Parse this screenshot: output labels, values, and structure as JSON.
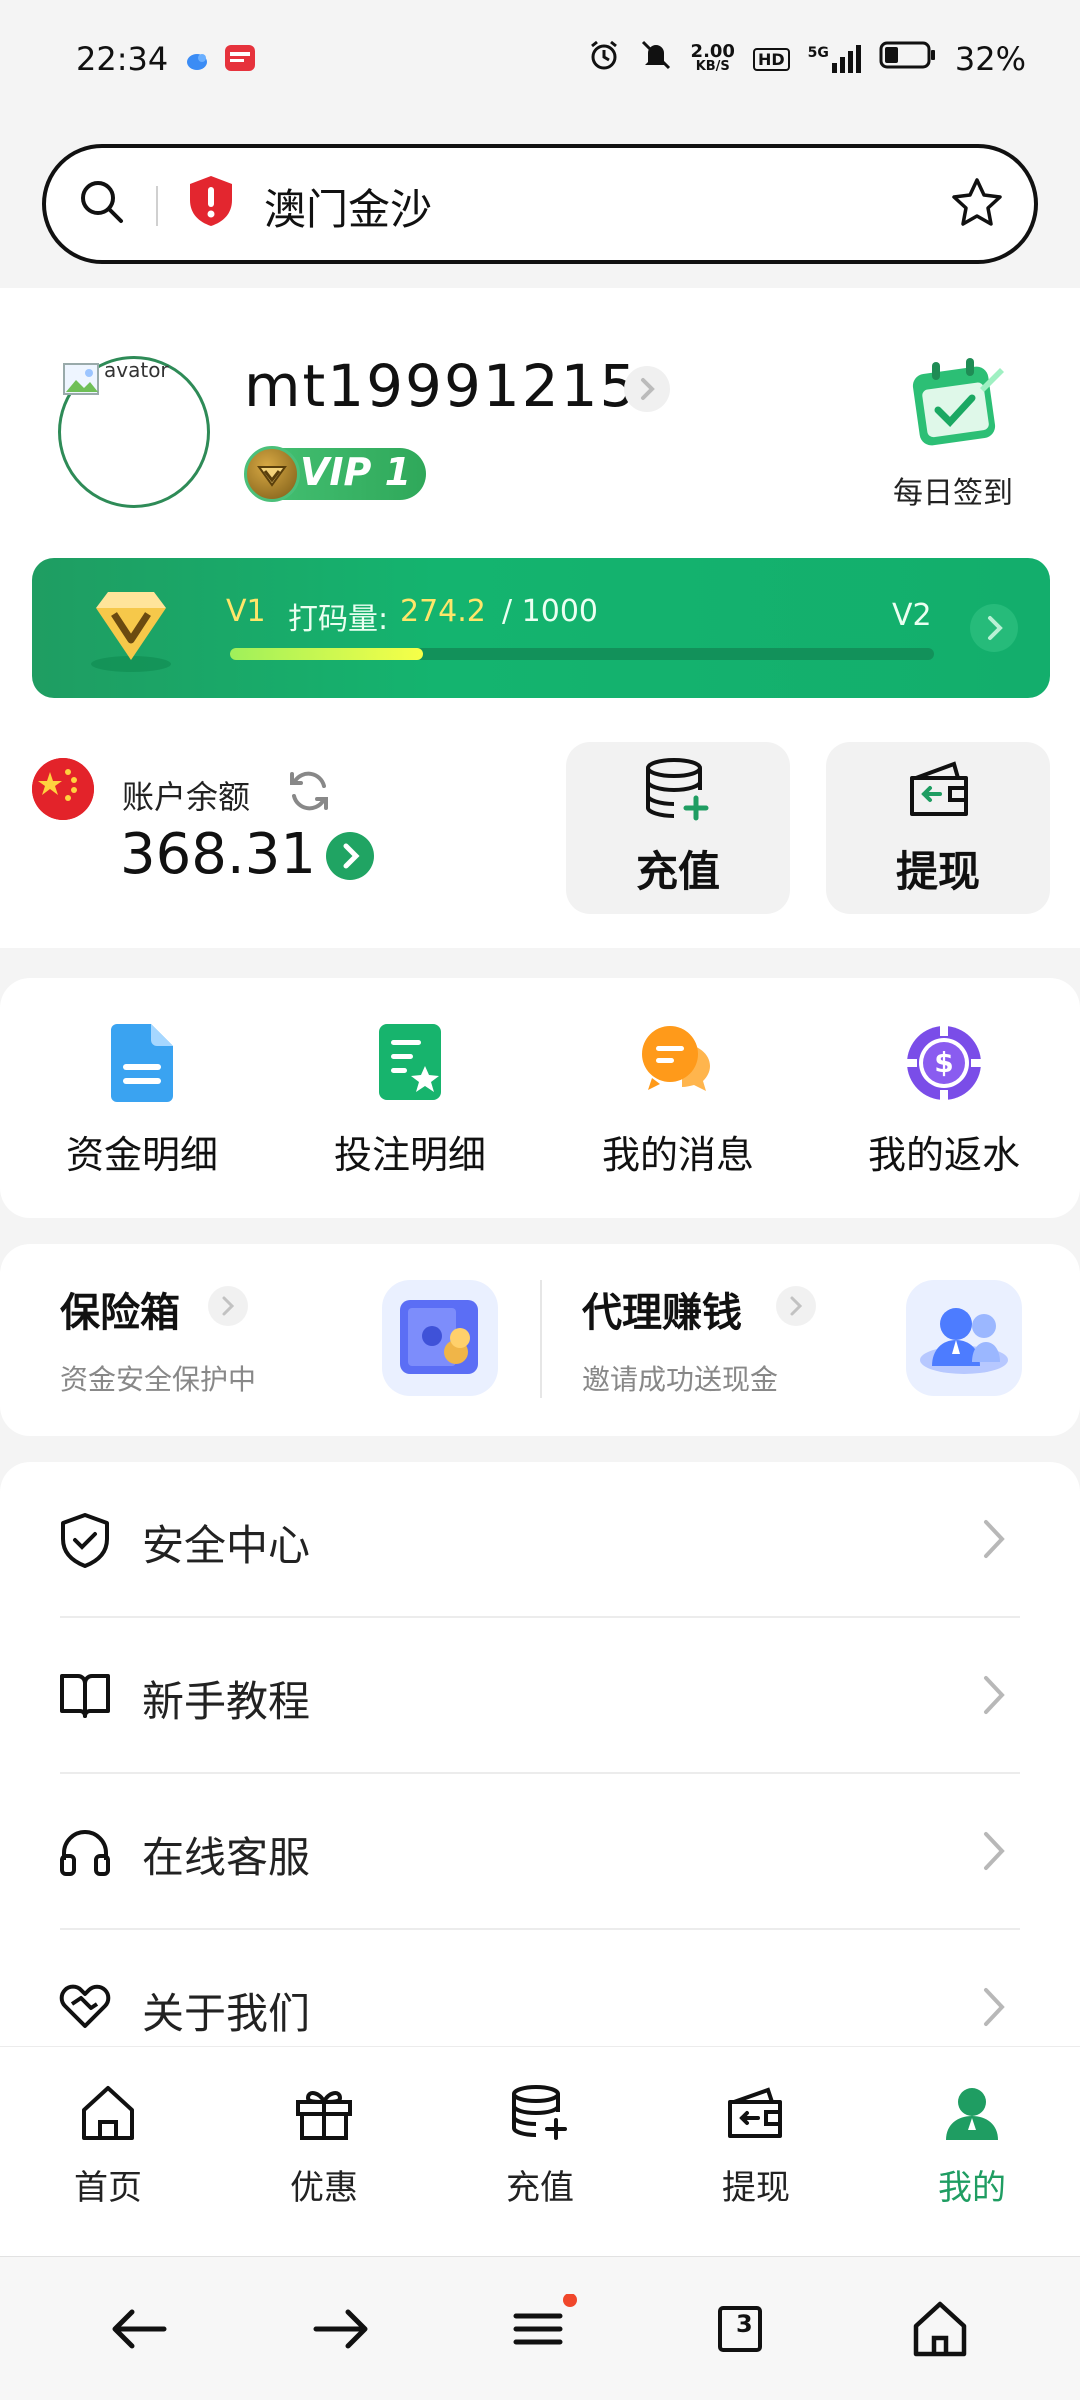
{
  "status_bar": {
    "time": "22:34",
    "network_speed_top": "2.00",
    "network_speed_unit": "KB/S",
    "hd": "HD",
    "network_type": "5G",
    "battery_percent": "32%",
    "battery_level": 0.32,
    "icons": [
      "bird-app-icon",
      "news-app-icon",
      "alarm-icon",
      "mute-icon",
      "signal-icon",
      "battery-icon"
    ]
  },
  "search": {
    "text": "澳门金沙"
  },
  "user": {
    "avatar_alt": "avator",
    "username": "mt19991215",
    "vip_label": "VIP 1"
  },
  "daily_signin": {
    "label": "每日签到"
  },
  "level": {
    "current": "V1",
    "label": "打码量:",
    "value": "274.2",
    "total": "/ 1000",
    "next": "V2",
    "progress": 0.2742
  },
  "account": {
    "label": "账户余额",
    "balance": "368.31"
  },
  "actions": {
    "deposit": "充值",
    "withdraw": "提现"
  },
  "quick": [
    {
      "label": "资金明细"
    },
    {
      "label": "投注明细"
    },
    {
      "label": "我的消息"
    },
    {
      "label": "我的返水"
    }
  ],
  "promo": {
    "safe_title": "保险箱",
    "safe_sub": "资金安全保护中",
    "agent_title": "代理赚钱",
    "agent_sub": "邀请成功送现金"
  },
  "menu": [
    {
      "label": "安全中心"
    },
    {
      "label": "新手教程"
    },
    {
      "label": "在线客服"
    },
    {
      "label": "关于我们"
    }
  ],
  "tabs": [
    {
      "label": "首页"
    },
    {
      "label": "优惠"
    },
    {
      "label": "充值"
    },
    {
      "label": "提现"
    },
    {
      "label": "我的"
    }
  ],
  "active_tab": "我的",
  "nav": {
    "tabs_count": "3"
  },
  "colors": {
    "brand_green": "#1f9d62",
    "accent_yellow": "#ffe66a"
  }
}
